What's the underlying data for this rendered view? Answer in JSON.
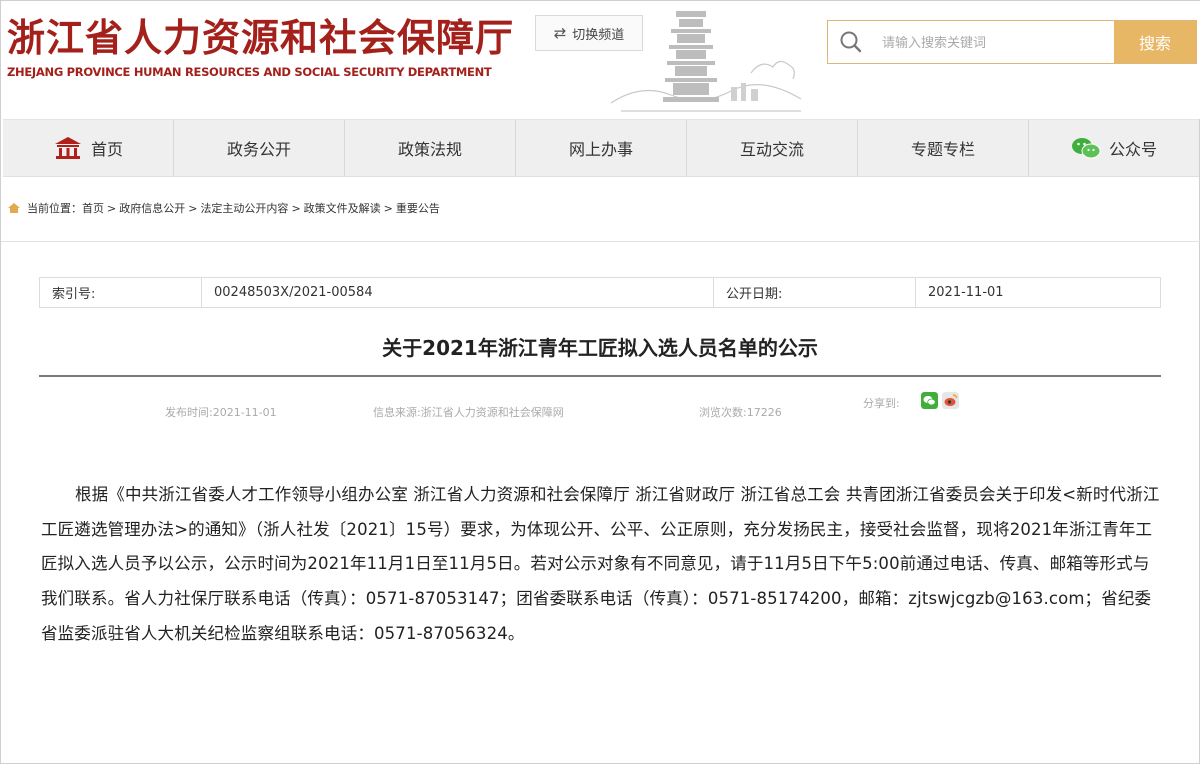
{
  "header": {
    "site_title": "浙江省人力资源和社会保障厅",
    "site_subtitle": "ZHEJANG PROVINCE HUMAN RESOURCES AND SOCIAL SECURITY DEPARTMENT",
    "switch_label": "切换频道",
    "search_placeholder": "请输入搜索关键词",
    "search_button": "搜索"
  },
  "nav": {
    "items": [
      {
        "label": "首页",
        "icon": "home-icon"
      },
      {
        "label": "政务公开"
      },
      {
        "label": "政策法规"
      },
      {
        "label": "网上办事"
      },
      {
        "label": "互动交流"
      },
      {
        "label": "专题专栏"
      },
      {
        "label": "公众号",
        "icon": "wechat-icon"
      }
    ]
  },
  "breadcrumb": {
    "prefix": "当前位置：",
    "items": [
      "首页",
      "政府信息公开",
      "法定主动公开内容",
      "政策文件及解读",
      "重要公告"
    ],
    "separator": ">"
  },
  "article": {
    "meta_table": {
      "index_label": "索引号:",
      "index_value": "00248503X/2021-00584",
      "date_label": "公开日期:",
      "date_value": "2021-11-01"
    },
    "title": "关于2021年浙江青年工匠拟入选人员名单的公示",
    "publish_time": "发布时间:2021-11-01",
    "source": "信息来源:浙江省人力资源和社会保障网",
    "views": "浏览次数:17226",
    "share_label": "分享到:",
    "body": "根据《中共浙江省委人才工作领导小组办公室 浙江省人力资源和社会保障厅 浙江省财政厅 浙江省总工会 共青团浙江省委员会关于印发<新时代浙江工匠遴选管理办法>的通知》（浙人社发〔2021〕15号）要求，为体现公开、公平、公正原则，充分发扬民主，接受社会监督，现将2021年浙江青年工匠拟入选人员予以公示，公示时间为2021年11月1日至11月5日。若对公示对象有不同意见，请于11月5日下午5:00前通过电话、传真、邮箱等形式与我们联系。省人力社保厅联系电话（传真）：0571-87053147；团省委联系电话（传真）：0571-85174200，邮箱：zjtswjcgzb@163.com；省纪委省监委派驻省人大机关纪检监察组联系电话：0571-87056324。"
  },
  "colors": {
    "brand_red": "#a3201b",
    "search_button": "#e8b765",
    "nav_bg": "#efefef",
    "wechat_green": "#3fae3a"
  }
}
